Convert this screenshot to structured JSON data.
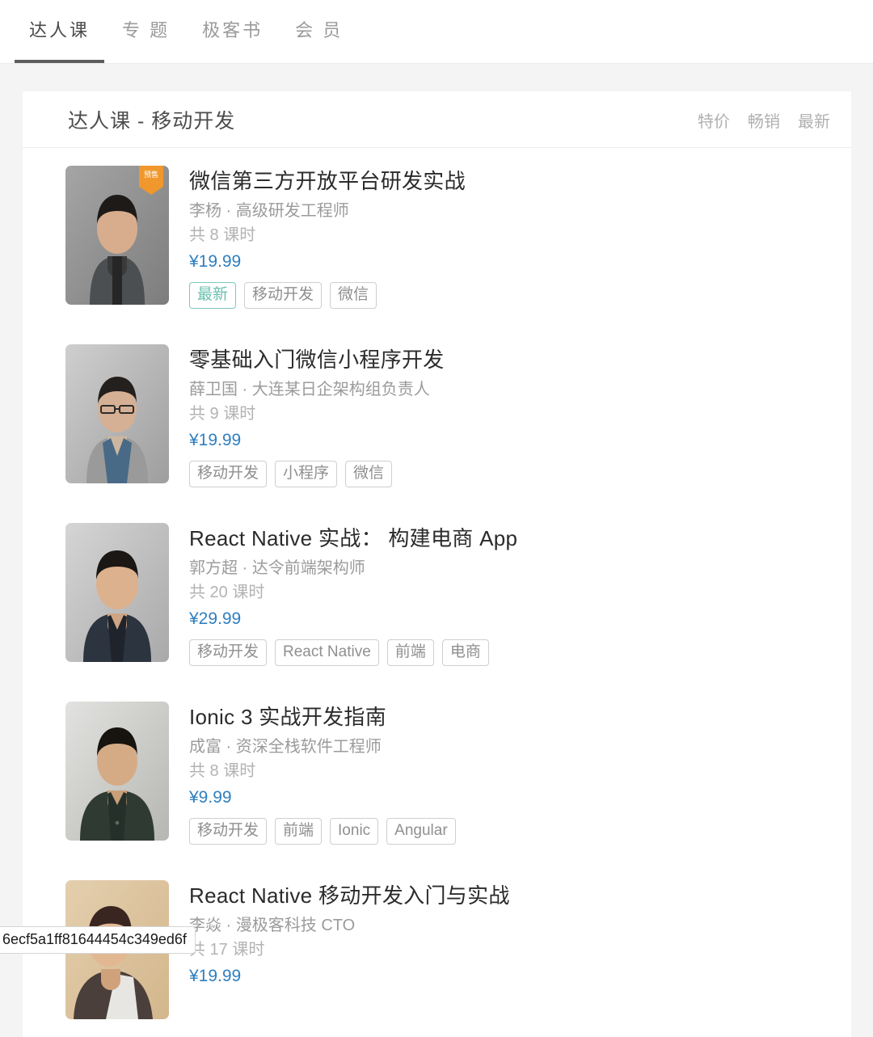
{
  "tabs": [
    {
      "label": "达人课",
      "active": true
    },
    {
      "label": "专 题",
      "active": false
    },
    {
      "label": "极客书",
      "active": false
    },
    {
      "label": "会 员",
      "active": false
    }
  ],
  "header": {
    "title": "达人课 - 移动开发",
    "sort_options": [
      "特价",
      "畅销",
      "最新"
    ]
  },
  "colors": {
    "price": "#2f7fbf",
    "accent_tag": "#6dc0af",
    "badge": "#f0982d",
    "tab_active": "#4a4a4a",
    "page_bg": "#f4f4f4"
  },
  "courses": [
    {
      "title": "微信第三方开放平台研发实战",
      "author": "李杨 · 高级研发工程师",
      "lessons": "共 8 课时",
      "price": "¥19.99",
      "badge": "预售",
      "tags": [
        {
          "label": "最新",
          "accent": true
        },
        {
          "label": "移动开发",
          "accent": false
        },
        {
          "label": "微信",
          "accent": false
        }
      ]
    },
    {
      "title": "零基础入门微信小程序开发",
      "author": "薛卫国 · 大连某日企架构组负责人",
      "lessons": "共 9 课时",
      "price": "¥19.99",
      "badge": "",
      "tags": [
        {
          "label": "移动开发",
          "accent": false
        },
        {
          "label": "小程序",
          "accent": false
        },
        {
          "label": "微信",
          "accent": false
        }
      ]
    },
    {
      "title": "React Native 实战： 构建电商 App",
      "author": "郭方超 · 达令前端架构师",
      "lessons": "共 20 课时",
      "price": "¥29.99",
      "badge": "",
      "tags": [
        {
          "label": "移动开发",
          "accent": false
        },
        {
          "label": "React Native",
          "accent": false
        },
        {
          "label": "前端",
          "accent": false
        },
        {
          "label": "电商",
          "accent": false
        }
      ]
    },
    {
      "title": "Ionic 3 实战开发指南",
      "author": "成富 · 资深全栈软件工程师",
      "lessons": "共 8 课时",
      "price": "¥9.99",
      "badge": "",
      "tags": [
        {
          "label": "移动开发",
          "accent": false
        },
        {
          "label": "前端",
          "accent": false
        },
        {
          "label": "Ionic",
          "accent": false
        },
        {
          "label": "Angular",
          "accent": false
        }
      ]
    },
    {
      "title": "React Native 移动开发入门与实战",
      "author": "李焱 · 漫极客科技 CTO",
      "lessons": "共 17 课时",
      "price": "¥19.99",
      "badge": "",
      "tags": []
    }
  ],
  "status_bar": {
    "text": "6ecf5a1ff81644454c349ed6f"
  }
}
